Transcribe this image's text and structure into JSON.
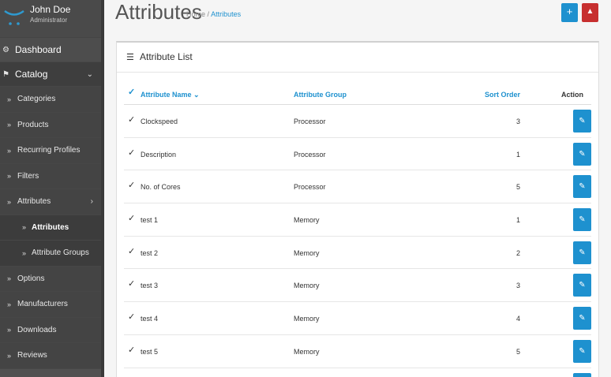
{
  "profile": {
    "name": "John Doe",
    "role": "Administrator"
  },
  "sidebar": {
    "dashboard": "Dashboard",
    "catalog": "Catalog",
    "items": [
      {
        "label": "Categories"
      },
      {
        "label": "Products"
      },
      {
        "label": "Recurring Profiles"
      },
      {
        "label": "Filters"
      },
      {
        "label": "Attributes"
      },
      {
        "label": "Attributes"
      },
      {
        "label": "Attribute Groups"
      },
      {
        "label": "Options"
      },
      {
        "label": "Manufacturers"
      },
      {
        "label": "Downloads"
      },
      {
        "label": "Reviews"
      }
    ]
  },
  "header": {
    "title": "Attributes",
    "breadcrumb": {
      "home": "Home",
      "separator": "/",
      "current": "Attributes"
    },
    "add_label": "+"
  },
  "panel": {
    "title": "Attribute List"
  },
  "table": {
    "headers": {
      "name": "Attribute Name",
      "group": "Attribute Group",
      "sort": "Sort Order",
      "action": "Action"
    },
    "rows": [
      {
        "name": "Clockspeed",
        "group": "Processor",
        "sort": "3"
      },
      {
        "name": "Description",
        "group": "Processor",
        "sort": "1"
      },
      {
        "name": "No. of Cores",
        "group": "Processor",
        "sort": "5"
      },
      {
        "name": "test 1",
        "group": "Memory",
        "sort": "1"
      },
      {
        "name": "test 2",
        "group": "Memory",
        "sort": "2"
      },
      {
        "name": "test 3",
        "group": "Memory",
        "sort": "3"
      },
      {
        "name": "test 4",
        "group": "Memory",
        "sort": "4"
      },
      {
        "name": "test 5",
        "group": "Memory",
        "sort": "5"
      }
    ]
  },
  "colors": {
    "accent": "#1e91cf",
    "danger": "#c72f2f",
    "sidebar": "#515151"
  },
  "icons": {
    "dashboard": "dashboard-icon",
    "catalog": "tag-icon",
    "list": "list-icon",
    "edit": "pencil-icon",
    "delete": "trash-icon",
    "checkbox": "check-icon"
  }
}
